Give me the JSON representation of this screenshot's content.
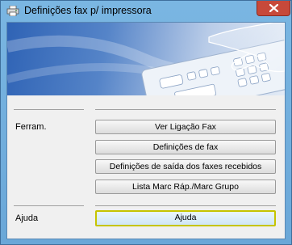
{
  "window": {
    "title": "Definições fax p/ impressora",
    "icon": "printer-fax-icon",
    "close_icon": "close-icon"
  },
  "banner": {
    "image": "hand-pressing-fax-keypad-illustration"
  },
  "sections": {
    "tools": {
      "label": "Ferram.",
      "buttons": [
        {
          "label": "Ver Ligação Fax"
        },
        {
          "label": "Definições de fax"
        },
        {
          "label": "Definições de saída dos faxes recebidos"
        },
        {
          "label": "Lista Marc Ráp./Marc Grupo"
        }
      ]
    },
    "help": {
      "label": "Ajuda",
      "button": {
        "label": "Ajuda"
      }
    }
  },
  "colors": {
    "title_bar": "#7ab6e2",
    "close_button": "#c7493a",
    "focus_border": "#c6c400"
  }
}
